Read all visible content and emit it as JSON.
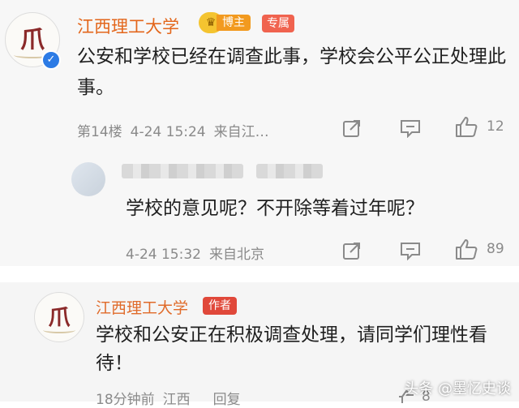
{
  "comment1": {
    "author": "江西理工大学",
    "badge_blogger": "博主",
    "badge_pinned": "专属",
    "text": "公安和学校已经在调查此事，学校会公平公正处理此事。",
    "floor": "第14楼",
    "time": "4-24 15:24",
    "location": "来自江…",
    "likes": "12"
  },
  "reply": {
    "text": "学校的意见呢？不开除等着过年呢？",
    "time": "4-24 15:32",
    "location": "来自北京",
    "likes": "89"
  },
  "comment2": {
    "author": "江西理工大学",
    "badge_author": "作者",
    "text": "学校和公安正在积极调查处理，请同学们理性看待！",
    "time": "18分钟前",
    "location": "江西",
    "reply_label": "回复",
    "likes": "8"
  },
  "watermark": "头条 @墨忆史谈",
  "colors": {
    "name": "#e3661b",
    "tag_red": "#e0483a",
    "tag_orange": "#f29a1f",
    "muted": "#8a8a8a"
  }
}
